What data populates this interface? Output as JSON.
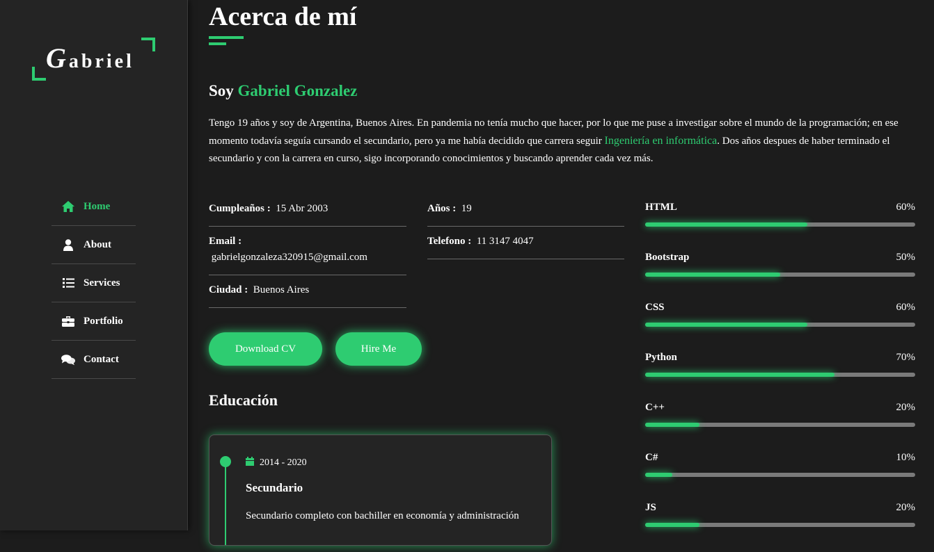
{
  "logo": {
    "first_letter": "G",
    "rest": "abriel"
  },
  "nav": {
    "items": [
      {
        "label": "Home",
        "icon": "home-icon",
        "active": true
      },
      {
        "label": "About",
        "icon": "user-icon",
        "active": false
      },
      {
        "label": "Services",
        "icon": "list-icon",
        "active": false
      },
      {
        "label": "Portfolio",
        "icon": "briefcase-icon",
        "active": false
      },
      {
        "label": "Contact",
        "icon": "comments-icon",
        "active": false
      }
    ]
  },
  "about": {
    "title": "Acerca de mí",
    "heading_prefix": "Soy ",
    "heading_name": "Gabriel Gonzalez",
    "intro_part1": "Tengo 19 años y soy de Argentina, Buenos Aires. En pandemia no tenía mucho que hacer, por lo que me puse a investigar sobre el mundo de la programación; en ese momento todavía seguía cursando el secundario, pero ya me había decidido que carrera seguir ",
    "intro_highlight": "Ingeniería en informática",
    "intro_part2": ". Dos años despues de haber terminado el secundario y con la carrera en curso, sigo incorporando conocimientos y buscando aprender cada vez más."
  },
  "info": {
    "birthday_label": "Cumpleaños :",
    "birthday_value": "15 Abr 2003",
    "email_label": "Email :",
    "email_value": "gabrielgonzaleza320915@gmail.com",
    "city_label": "Ciudad :",
    "city_value": "Buenos Aires",
    "age_label": "Años :",
    "age_value": "19",
    "phone_label": "Telefono :",
    "phone_value": "11 3147 4047"
  },
  "buttons": {
    "download_cv": "Download CV",
    "hire_me": "Hire Me"
  },
  "education": {
    "title": "Educación",
    "items": [
      {
        "date": "2014 - 2020",
        "title": "Secundario",
        "description": "Secundario completo con bachiller en economía y administración"
      }
    ]
  },
  "skills": [
    {
      "name": "HTML",
      "percent_label": "60%",
      "value": 60
    },
    {
      "name": "Bootstrap",
      "percent_label": "50%",
      "value": 50
    },
    {
      "name": "CSS",
      "percent_label": "60%",
      "value": 60
    },
    {
      "name": "Python",
      "percent_label": "70%",
      "value": 70
    },
    {
      "name": "C++",
      "percent_label": "20%",
      "value": 20
    },
    {
      "name": "C#",
      "percent_label": "10%",
      "value": 10
    },
    {
      "name": "JS",
      "percent_label": "20%",
      "value": 20
    }
  ],
  "colors": {
    "accent": "#2ecc71",
    "background": "#1c1c1c",
    "sidebar": "#242424"
  }
}
